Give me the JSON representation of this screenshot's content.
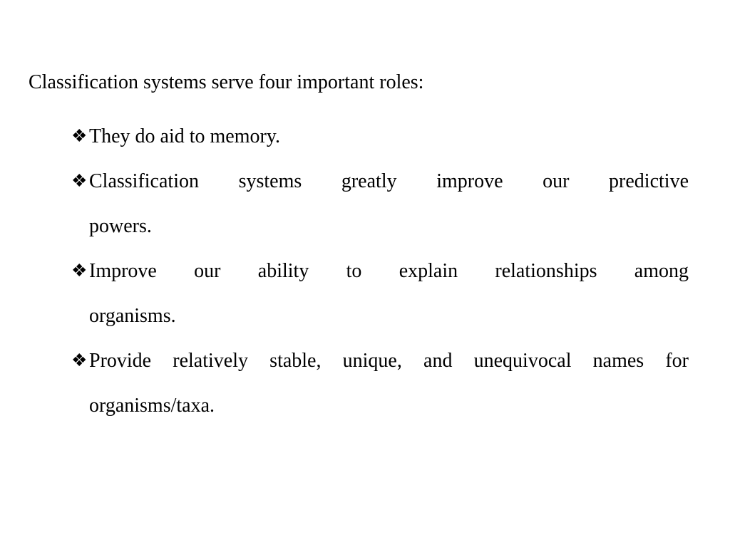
{
  "slide": {
    "lead_in": "Classification systems serve four important roles:",
    "bullet_marker": "❖",
    "bullet_marker_name": "diamond-bullet-icon",
    "text_color": "#000000",
    "background_color": "#ffffff",
    "bullets": [
      {
        "id": "aid-to-memory",
        "full_text": "They do aid to memory.",
        "lines": [
          {
            "text": "They do aid to memory.",
            "justified": false
          }
        ]
      },
      {
        "id": "predictive-powers",
        "full_text": "Classification systems greatly improve our predictive powers.",
        "lines": [
          {
            "text": "Classification systems greatly improve our predictive",
            "justified": true
          },
          {
            "text": "powers.",
            "justified": false
          }
        ]
      },
      {
        "id": "explain-relationships",
        "full_text": "Improve our ability to explain relationships among organisms.",
        "lines": [
          {
            "text": "Improve our ability to explain relationships among",
            "justified": true
          },
          {
            "text": "organisms.",
            "justified": false
          }
        ]
      },
      {
        "id": "stable-unique-names",
        "full_text": "Provide relatively stable, unique, and unequivocal names for organisms/taxa.",
        "lines": [
          {
            "text": "Provide relatively stable, unique, and unequivocal names for",
            "justified": true
          },
          {
            "text": "organisms/taxa.",
            "justified": false
          }
        ]
      }
    ]
  }
}
